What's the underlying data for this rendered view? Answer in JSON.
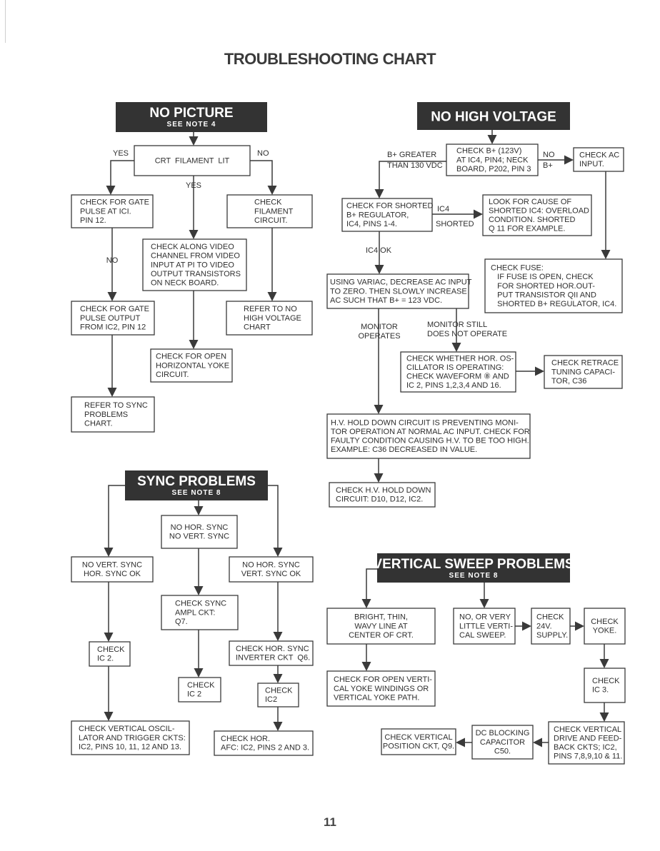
{
  "page": {
    "title": "TROUBLESHOOTING CHART",
    "page_number": "11"
  },
  "colors": {
    "header_fill": "#333333",
    "ink": "#3a3a3a",
    "paper": "#ffffff"
  },
  "no_picture": {
    "header": {
      "title": "NO PICTURE",
      "note": "SEE NOTE 4"
    },
    "crt_filament_lit": [
      "CRT  FILAMENT  LIT"
    ],
    "gate_pulse_ic1": [
      "CHECK FOR GATE",
      "PULSE AT ICI.",
      "PIN 12."
    ],
    "filament_circuit": [
      "CHECK",
      "FILAMENT",
      "CIRCUIT."
    ],
    "video_channel": [
      "CHECK ALONG VIDEO",
      "CHANNEL FROM VIDEO",
      "INPUT AT PI TO VIDEO",
      "OUTPUT TRANSISTORS",
      "ON NECK BOARD."
    ],
    "gate_pulse_ic2": [
      "CHECK FOR GATE",
      "PULSE OUTPUT",
      "FROM IC2, PIN 12"
    ],
    "refer_no_hv": [
      "REFER TO NO",
      "HIGH VOLTAGE",
      "CHART"
    ],
    "open_hor_yoke": [
      "CHECK FOR OPEN",
      "HORIZONTAL YOKE",
      "CIRCUIT."
    ],
    "refer_sync": [
      "REFER TO SYNC",
      "PROBLEMS",
      "CHART."
    ],
    "labels": {
      "yes_left": "YES",
      "no_right": "NO",
      "yes_center": "YES",
      "no_left": "NO"
    }
  },
  "no_high_voltage": {
    "header": {
      "title": "NO HIGH VOLTAGE"
    },
    "check_bplus": [
      "CHECK B+ (123V)",
      "AT IC4, PIN4; NECK",
      "BOARD, P202, PIN 3"
    ],
    "check_ac_input": [
      "CHECK AC",
      "INPUT."
    ],
    "shorted_regulator": [
      "CHECK FOR SHORTED",
      "B+ REGULATOR,",
      "IC4, PINS 1-4."
    ],
    "cause_shorted_ic4": [
      "LOOK FOR CAUSE OF",
      "SHORTED IC4: OVERLOAD",
      "CONDITION. SHORTED",
      "Q 11 FOR EXAMPLE."
    ],
    "check_fuse": [
      "CHECK FUSE:",
      "   IF FUSE IS OPEN, CHECK",
      "   FOR SHORTED HOR.OUT-",
      "   PUT TRANSISTOR QII AND",
      "   SHORTED B+ REGULATOR, IC4."
    ],
    "variac": [
      "USING VARIAC, DECREASE AC INPUT",
      "TO ZERO. THEN SLOWLY INCREASE",
      "AC SUCH THAT B+ = 123 VDC."
    ],
    "hor_oscillator": [
      "CHECK WHETHER HOR. OS-",
      "CILLATOR IS OPERATING:",
      "CHECK WAVEFORM ⑧ AND",
      "IC 2, PINS 1,2,3,4 AND 16."
    ],
    "retrace_cap": [
      "CHECK RETRACE",
      "TUNING CAPACI-",
      "TOR, C36"
    ],
    "hv_hold_down": [
      "H.V. HOLD DOWN CIRCUIT IS PREVENTING MONI-",
      "TOR OPERATION AT NORMAL AC INPUT. CHECK FOR",
      "FAULTY CONDITION CAUSING H.V. TO BE TOO HIGH.",
      "EXAMPLE: C36 DECREASED IN VALUE."
    ],
    "check_hv_circuit": [
      "CHECK H.V. HOLD DOWN",
      "CIRCUIT: D10, D12, IC2."
    ],
    "labels": {
      "bplus_greater": [
        "B+ GREATER",
        "THAN 130 VDC"
      ],
      "no_bplus": [
        "NO",
        "B+"
      ],
      "ic4_shorted": [
        "IC4",
        "SHORTED"
      ],
      "ic4_ok": "IC4 OK",
      "monitor_operates": [
        "MONITOR",
        "OPERATES"
      ],
      "monitor_still": [
        "MONITOR STILL",
        "DOES NOT OPERATE"
      ]
    }
  },
  "sync_problems": {
    "header": {
      "title": "SYNC PROBLEMS",
      "note": "SEE NOTE 8"
    },
    "no_hor_no_vert": [
      "NO HOR. SYNC",
      "NO VERT. SYNC"
    ],
    "no_vert_hor_ok": [
      "NO VERT. SYNC",
      "HOR. SYNC OK"
    ],
    "no_hor_vert_ok": [
      "NO HOR. SYNC",
      "VERT. SYNC OK"
    ],
    "sync_ampl": [
      "CHECK SYNC",
      "AMPL CKT:",
      "Q7."
    ],
    "check_ic2_left": [
      "CHECK",
      "IC 2."
    ],
    "hor_sync_inverter": [
      "CHECK HOR. SYNC",
      "INVERTER CKT  Q6."
    ],
    "check_ic2_mid": [
      "CHECK",
      "IC 2"
    ],
    "check_ic2_right": [
      "CHECK",
      "IC2"
    ],
    "vert_oscillator": [
      "CHECK VERTICAL OSCIL-",
      "LATOR AND TRIGGER CKTS:",
      "IC2, PINS 10, 11, 12 AND 13."
    ],
    "hor_afc": [
      "CHECK HOR.",
      "AFC: IC2, PINS 2 AND 3."
    ]
  },
  "vertical_sweep": {
    "header": {
      "title": "VERTICAL SWEEP PROBLEMS",
      "note": "SEE NOTE 8"
    },
    "bright_line": [
      "BRIGHT, THIN,",
      "WAVY LINE AT",
      "CENTER OF CRT."
    ],
    "little_sweep": [
      "NO, OR VERY",
      "LITTLE VERTI-",
      "CAL SWEEP."
    ],
    "check_24v": [
      "CHECK",
      "24V.",
      "SUPPLY."
    ],
    "check_yoke": [
      "CHECK",
      "YOKE."
    ],
    "open_windings": [
      "CHECK FOR OPEN VERTI-",
      "CAL YOKE WINDINGS OR",
      "VERTICAL YOKE PATH."
    ],
    "check_ic3": [
      "CHECK",
      "IC 3."
    ],
    "drive_feedback": [
      "CHECK VERTICAL",
      "DRIVE AND FEED-",
      "BACK CKTS; IC2,",
      "PINS 7,8,9,10 & 11."
    ],
    "dc_blocking": [
      "DC BLOCKING",
      "CAPACITOR",
      "C50."
    ],
    "vert_position": [
      "CHECK VERTICAL",
      "POSITION CKT, Q9."
    ]
  }
}
